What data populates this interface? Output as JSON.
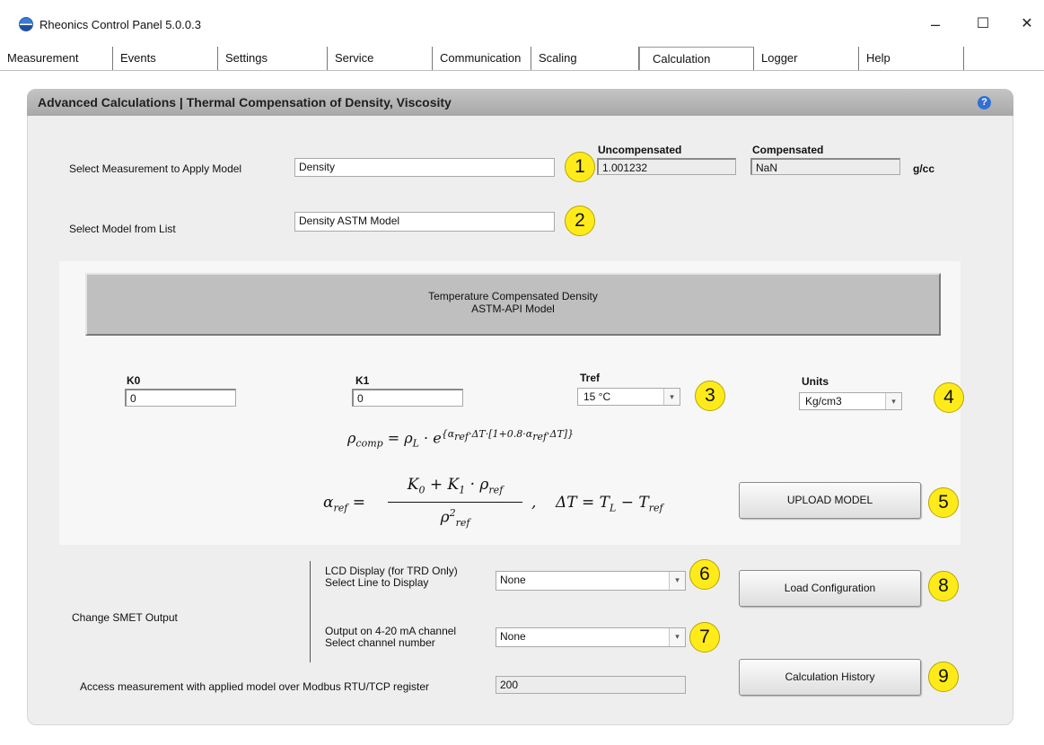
{
  "window": {
    "title": "Rheonics Control Panel 5.0.0.3",
    "minimize": "–",
    "maximize": "☐",
    "close": "✕"
  },
  "tabs": [
    {
      "label": "Measurement",
      "active": false
    },
    {
      "label": "Events",
      "active": false
    },
    {
      "label": "Settings",
      "active": false
    },
    {
      "label": "Service",
      "active": false
    },
    {
      "label": "Communication",
      "active": false
    },
    {
      "label": "Scaling",
      "active": false
    },
    {
      "label": "Calculation",
      "active": true
    },
    {
      "label": "Logger",
      "active": false
    },
    {
      "label": "Help",
      "active": false
    }
  ],
  "panel": {
    "title": "Advanced Calculations | Thermal Compensation of Density, Viscosity",
    "help_icon": "?"
  },
  "measurement": {
    "label": "Select Measurement to Apply Model",
    "value": "Density",
    "uncompensated_label": "Uncompensated",
    "uncompensated_value": "1.001232",
    "compensated_label": "Compensated",
    "compensated_value": "NaN",
    "unit": "g/cc"
  },
  "model": {
    "label": "Select Model from List",
    "value": "Density ASTM Model",
    "box_line1": "Temperature Compensated Density",
    "box_line2": "ASTM-API Model"
  },
  "params": {
    "k0_label": "K0",
    "k0_value": "0",
    "k1_label": "K1",
    "k1_value": "0",
    "tref_label": "Tref",
    "tref_value": "15 °C",
    "units_label": "Units",
    "units_value": "Kg/cm3"
  },
  "formula": {
    "eq1": "ρcomp = ρL · e^{αref·ΔT·[1+0.8·αref·ΔT]}",
    "eq2": "αref = (K0 + K1 · ρref) / ρref² , ΔT = TL − Tref"
  },
  "buttons": {
    "upload": "UPLOAD MODEL",
    "load_config": "Load Configuration",
    "history": "Calculation History"
  },
  "smet": {
    "label": "Change SMET Output",
    "lcd_line1": "LCD Display (for TRD Only)",
    "lcd_line2": "Select Line to Display",
    "lcd_value": "None",
    "out_line1": "Output on 4-20 mA channel",
    "out_line2": "Select channel number",
    "out_value": "None"
  },
  "modbus": {
    "label": "Access measurement with applied model over Modbus RTU/TCP register",
    "value": "200"
  },
  "badges": [
    "1",
    "2",
    "3",
    "4",
    "5",
    "6",
    "7",
    "8",
    "9"
  ]
}
